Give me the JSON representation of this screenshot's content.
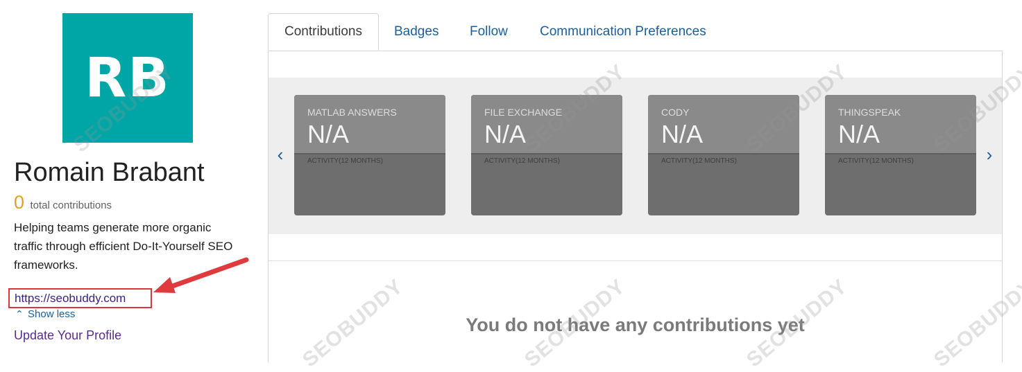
{
  "profile": {
    "avatar_initials": "RB",
    "avatar_color": "#00a6a6",
    "name": "Romain Brabant",
    "contribution_count": "0",
    "contribution_label": "total contributions",
    "bio": "Helping teams generate more organic traffic through efficient Do-It-Yourself SEO frameworks.",
    "website": "https://seobuddy.com",
    "show_less": "Show less",
    "update_profile": "Update Your Profile"
  },
  "tabs": [
    {
      "label": "Contributions",
      "active": true
    },
    {
      "label": "Badges",
      "active": false
    },
    {
      "label": "Follow",
      "active": false
    },
    {
      "label": "Communication Preferences",
      "active": false
    }
  ],
  "cards": [
    {
      "title": "MATLAB ANSWERS",
      "value": "N/A",
      "subtitle": "ACTIVITY(12 MONTHS)"
    },
    {
      "title": "FILE EXCHANGE",
      "value": "N/A",
      "subtitle": "ACTIVITY(12 MONTHS)"
    },
    {
      "title": "CODY",
      "value": "N/A",
      "subtitle": "ACTIVITY(12 MONTHS)"
    },
    {
      "title": "THINGSPEAK",
      "value": "N/A",
      "subtitle": "ACTIVITY(12 MONTHS)"
    }
  ],
  "carousel": {
    "prev_icon": "chevron-left-icon",
    "next_icon": "chevron-right-icon"
  },
  "empty_message": "You do not have any contributions yet",
  "watermark": "SEOBUDDY",
  "colors": {
    "link": "#1a5f9a",
    "highlight_border": "#d9373d",
    "accent_count": "#e3a21a"
  }
}
